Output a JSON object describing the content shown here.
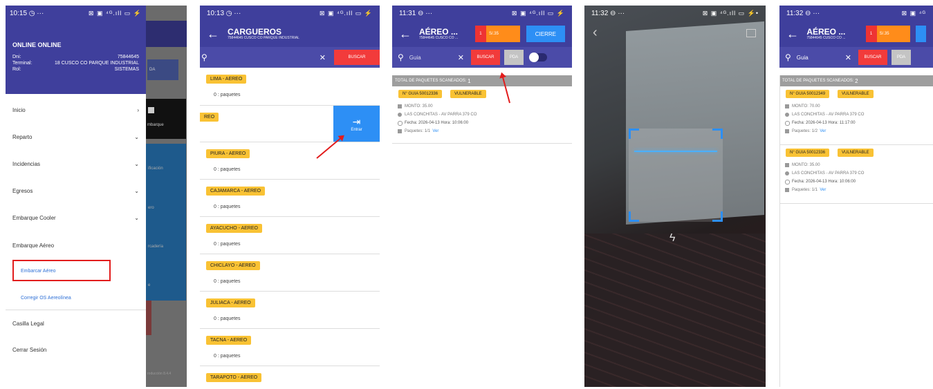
{
  "screen1": {
    "status": {
      "time": "10:15 ◷ ···",
      "icons": "⊠ ▣ ⁴ᴳ.ıll ▭ ⚡"
    },
    "drawer": {
      "title": "ONLINE ONLINE",
      "dni_label": "Dni:",
      "dni_value": "75844645",
      "terminal_label": "Terminal:",
      "terminal_value": "18 CUSCO CO PARQUE INDUSTRIAL",
      "rol_label": "Rol:",
      "rol_value": "SISTEMAS",
      "items": [
        "Inicio",
        "Reparto",
        "Incidencias",
        "Egresos",
        "Embarque Cooler",
        "Embarque Aéreo"
      ],
      "subitems": [
        "Embarcar Aéreo",
        "Corregir OS Aereolínea"
      ],
      "bottom_items": [
        "Casilla Legal",
        "Cerrar Sesión"
      ],
      "chev_right": "›",
      "chev_down": "⌄"
    },
    "background": {
      "a": "DA",
      "b": "mbarque",
      "c": "ificación",
      "d": "ero",
      "e": "rcadería",
      "f": "e",
      "footer": "roducción 8.4.4"
    }
  },
  "screen2": {
    "status": {
      "time": "10:13 ◷ ···",
      "icons": "⊠ ▣ ⁴ᴳ.ıll ▭ ⚡"
    },
    "title": "CARGUEROS",
    "subtitle": "75844645 CUSCO CO PARQUE INDUSTRIAL",
    "search_icon": "⚲",
    "clear_icon": "✕",
    "search_button": "BUSCAR",
    "items": [
      {
        "label": "LIMA - AEREO",
        "count": "0 : paquetes"
      },
      {
        "label": "REO",
        "count": ""
      },
      {
        "label": "PIURA - AEREO",
        "count": "0 : paquetes"
      },
      {
        "label": "CAJAMARCA - AEREO",
        "count": "0 : paquetes"
      },
      {
        "label": "AYACUCHO - AEREO",
        "count": "0 : paquetes"
      },
      {
        "label": "CHICLAYO - AEREO",
        "count": "0 : paquetes"
      },
      {
        "label": "JULIACA - AEREO",
        "count": "0 : paquetes"
      },
      {
        "label": "TACNA - AEREO",
        "count": "0 : paquetes"
      },
      {
        "label": "TARAPOTO - AEREO",
        "count": ""
      }
    ],
    "enter_icon": "⇥",
    "enter_label": "Entrar"
  },
  "screen3": {
    "status": {
      "time": "11:31 ⊖ ···",
      "icons": "⊠ ▣ ⁴ᴳ.ıll ▭ ⚡"
    },
    "title": "AÉREO ...",
    "subtitle": "75844645 CUSCO CO ...",
    "counter": "1",
    "amount": "S/.35",
    "close_button": "CIERRE",
    "search_placeholder": "Guia",
    "search_button": "BUSCAR",
    "pda_button": "PDA",
    "scanned_label": "TOTAL DE PAQUETES SCANEADOS:",
    "scanned_count": "1",
    "card": {
      "guia": "N° GUIA 50012336",
      "badge": "VULNERABLE",
      "monto": "MONTO: 35.00",
      "address": "LAS CONCHITAS - AV PARRA 379 CO",
      "fecha": "Fecha: 2026-04-13 Hora: 10:06:00",
      "paquetes": "Paquetes: 1/1",
      "ver": "Ver"
    }
  },
  "screen4": {
    "status": {
      "time": "11:32 ⊖ ···",
      "icons": "⊠ ▣ ⁴ᴳ.ıll ▭ ⚡•"
    },
    "back_icon": "‹",
    "flash_icon": "ϟ"
  },
  "screen5": {
    "status": {
      "time": "11:32 ⊖ ···",
      "icons": "⊠ ▣ ⁴ᴳ"
    },
    "title": "AÉREO ...",
    "subtitle": "75844645 CUSCO CO ...",
    "counter": "1",
    "amount": "S/.35",
    "search_value": "Guia",
    "search_button": "BUSCAR",
    "pda_button": "PDA",
    "scanned_label": "TOTAL DE PAQUETES SCANEADOS:",
    "scanned_count": "2",
    "cards": [
      {
        "guia": "N° GUIA 50012349",
        "badge": "VULNERABLE",
        "monto": "MONTO: 70.00",
        "address": "LAS CONCHITAS - AV PARRA 379 CO",
        "fecha": "Fecha: 2026-04-13 Hora: 11:17:00",
        "paquetes": "Paquetes: 1/2",
        "ver": "Ver"
      },
      {
        "guia": "N° GUIA 50012336",
        "badge": "VULNERABLE",
        "monto": "MONTO: 35.00",
        "address": "LAS CONCHITAS - AV PARRA 379 CO",
        "fecha": "Fecha: 2026-04-13 Hora: 10:06:00",
        "paquetes": "Paquetes: 1/1",
        "ver": "Ver"
      }
    ]
  },
  "colors": {
    "primary": "#3f3f9c",
    "accent_yellow": "#f9c234",
    "red": "#f23b3b",
    "blue": "#2d8ff5",
    "orange": "#ff8c1a"
  }
}
